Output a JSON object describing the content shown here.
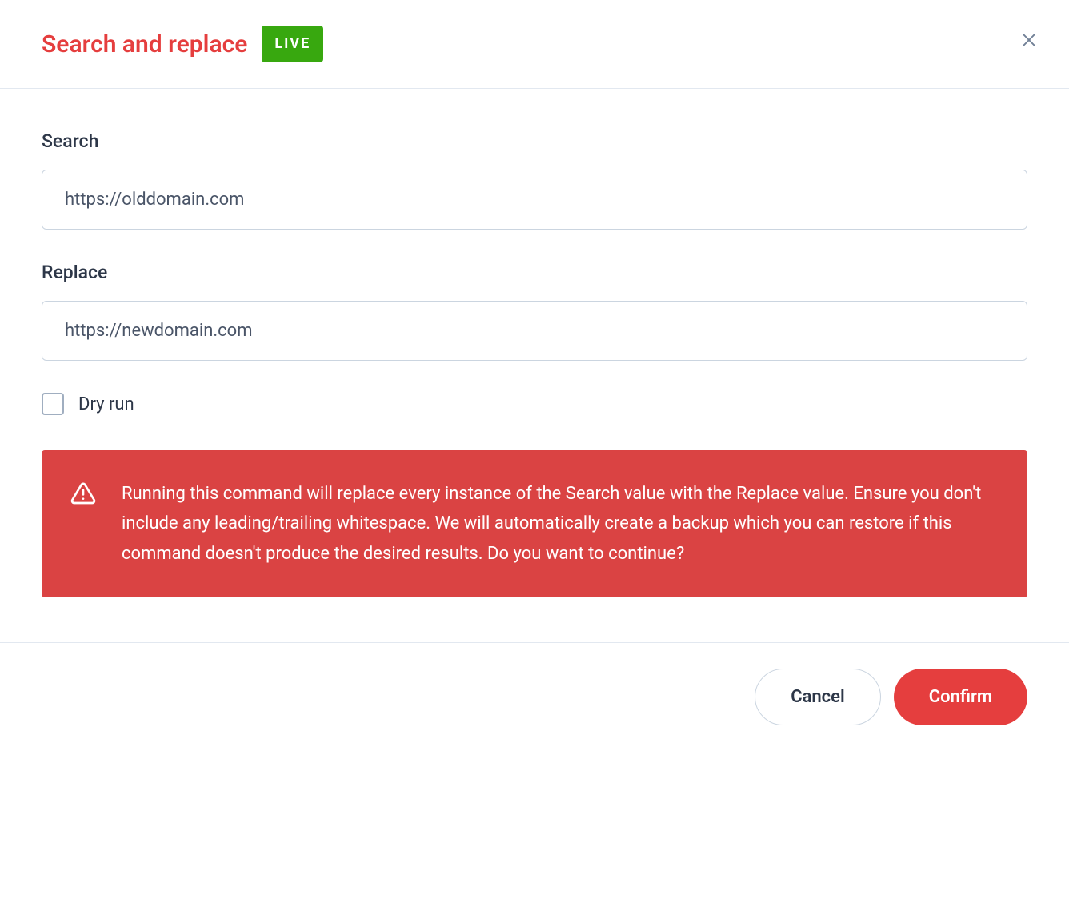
{
  "header": {
    "title": "Search and replace",
    "badge": "LIVE"
  },
  "form": {
    "search_label": "Search",
    "search_value": "https://olddomain.com",
    "replace_label": "Replace",
    "replace_value": "https://newdomain.com",
    "dry_run_label": "Dry run"
  },
  "alert": {
    "message": "Running this command will replace every instance of the Search value with the Replace value. Ensure you don't include any leading/trailing whitespace. We will automatically create a backup which you can restore if this command doesn't produce the desired results. Do you want to continue?"
  },
  "footer": {
    "cancel_label": "Cancel",
    "confirm_label": "Confirm"
  }
}
